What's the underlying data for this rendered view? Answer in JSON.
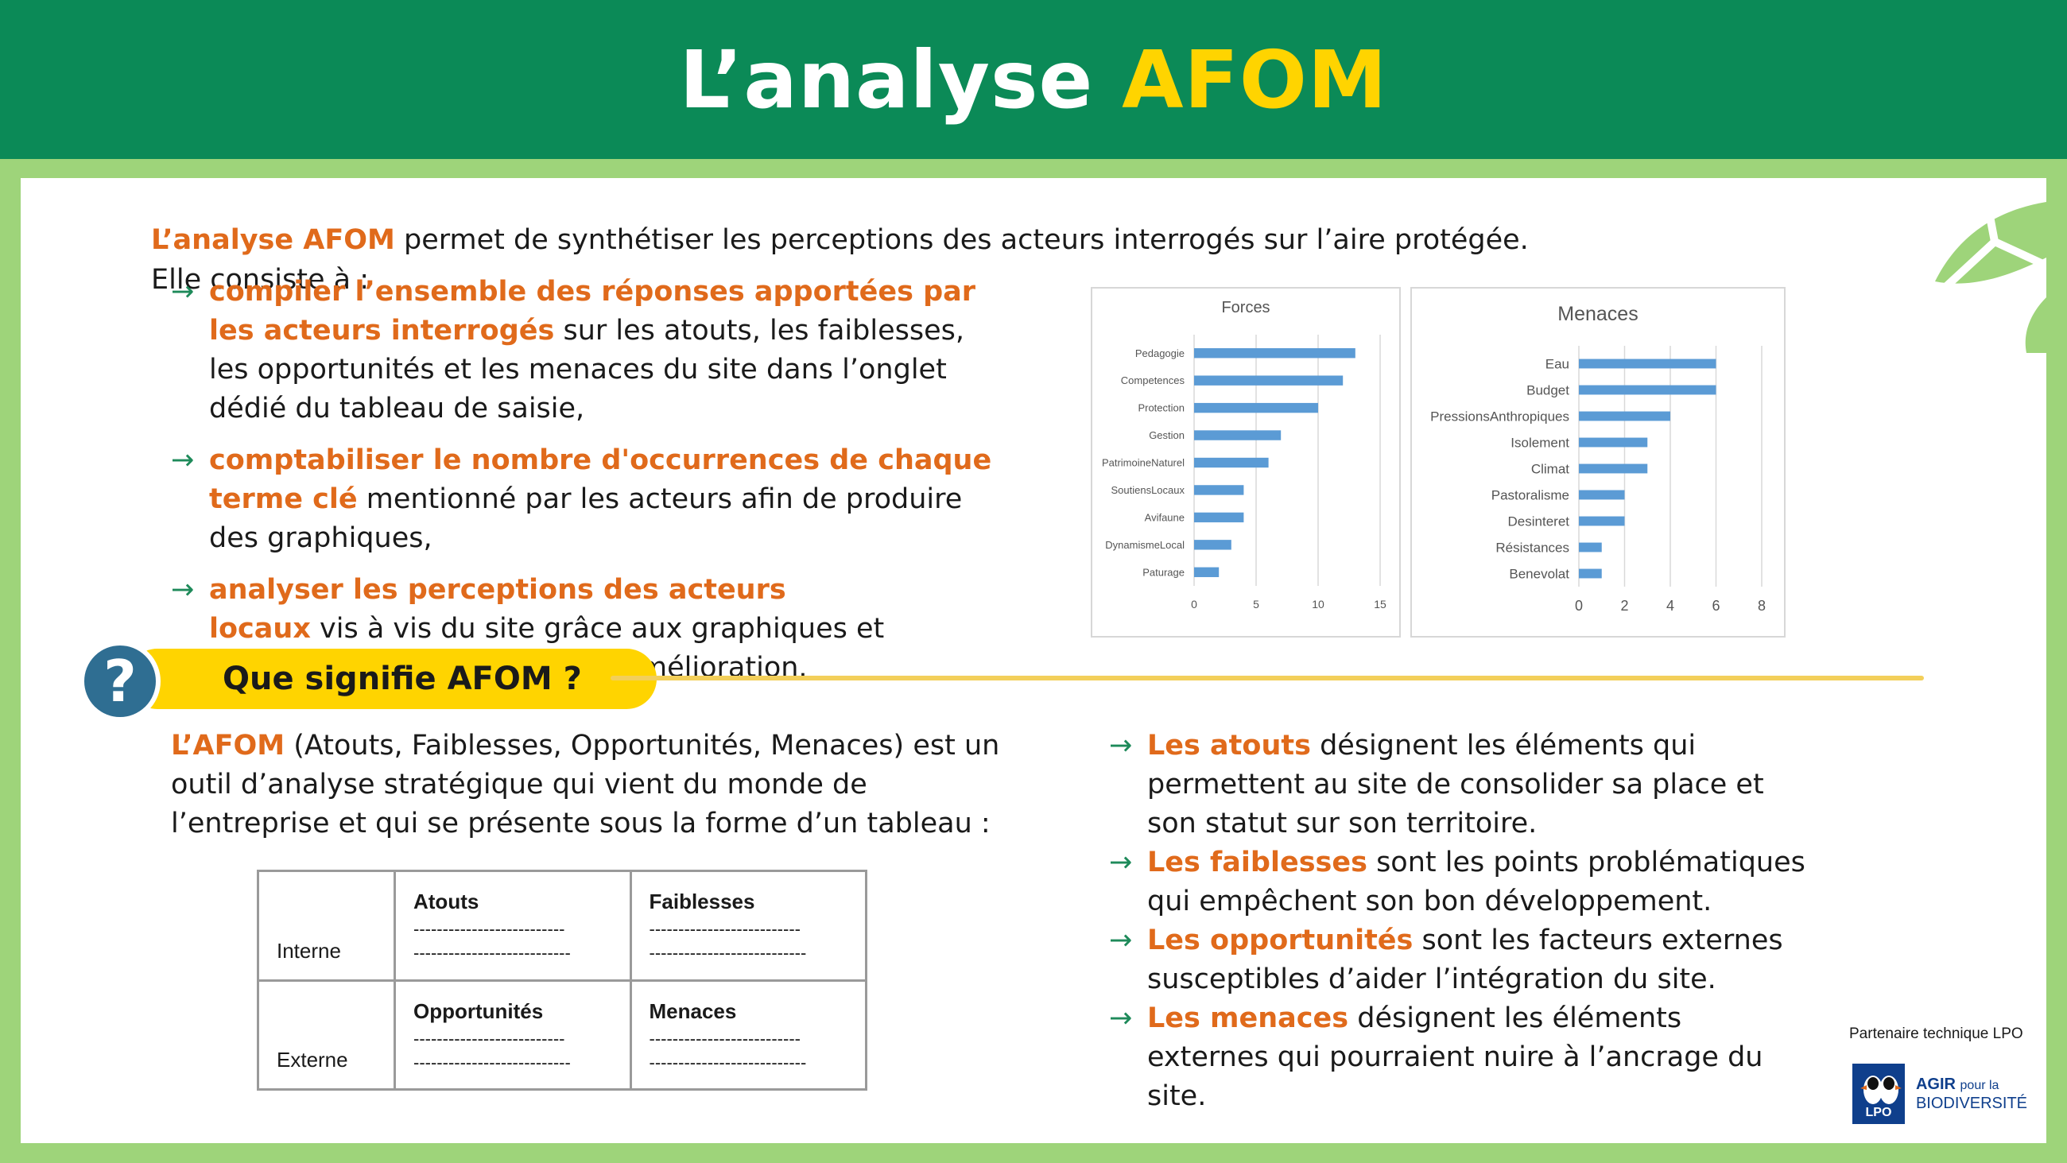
{
  "header": {
    "title_part1": "L’analyse ",
    "title_part2": "AFOM"
  },
  "intro": {
    "lead_bold": "L’analyse AFOM",
    "lead_rest": " permet de synthétiser les perceptions des acteurs interrogés sur l’aire protégée. Elle consiste à :"
  },
  "bullets": [
    {
      "arrow": "→",
      "bold": "compiler l’ensemble des réponses apportées par les acteurs interrogés",
      "rest": " sur les atouts, les faiblesses, les opportunités et les menaces du site dans l’onglet dédié du tableau de saisie,"
    },
    {
      "arrow": "→",
      "bold": "comptabiliser le nombre d'occurrences de chaque terme clé",
      "rest": " mentionné par les acteurs afin de produire des graphiques,"
    },
    {
      "arrow": "→",
      "bold": "analyser les perceptions des acteurs locaux",
      "rest": " vis à vis du site grâce aux graphiques et identifier les premiers axes d’amélioration."
    }
  ],
  "chart_data": [
    {
      "type": "bar",
      "orientation": "horizontal",
      "title": "Forces",
      "categories": [
        "Pedagogie",
        "Competences",
        "Protection",
        "Gestion",
        "PatrimoineNaturel",
        "SoutiensLocaux",
        "Avifaune",
        "DynamismeLocal",
        "Paturage"
      ],
      "values": [
        13,
        12,
        10,
        7,
        6,
        4,
        4,
        3,
        2
      ],
      "xlim": [
        0,
        15
      ],
      "xticks": [
        0,
        5,
        10,
        15
      ],
      "grid": true,
      "color": "#5b9bd5"
    },
    {
      "type": "bar",
      "orientation": "horizontal",
      "title": "Menaces",
      "categories": [
        "Eau",
        "Budget",
        "PressionsAnthropiques",
        "Isolement",
        "Climat",
        "Pastoralisme",
        "Desinteret",
        "Résistances",
        "Benevolat"
      ],
      "values": [
        6,
        6,
        4,
        3,
        3,
        2,
        2,
        1,
        1
      ],
      "xlim": [
        0,
        8
      ],
      "xticks": [
        0,
        2,
        4,
        6,
        8
      ],
      "grid": true,
      "color": "#5b9bd5"
    }
  ],
  "section": {
    "icon": "?",
    "title": "Que signifie AFOM ?"
  },
  "definition": {
    "bold": "L’AFOM",
    "rest": " (Atouts, Faiblesses, Opportunités, Menaces) est un outil d’analyse stratégique qui vient du monde de l’entreprise et qui se présente sous la forme d’un tableau :"
  },
  "table": {
    "rows": [
      {
        "label": "Interne",
        "cells": [
          {
            "title": "Atouts",
            "line1": "--------------------------",
            "line2": "---------------------------"
          },
          {
            "title": "Faiblesses",
            "line1": "--------------------------",
            "line2": "---------------------------"
          }
        ]
      },
      {
        "label": "Externe",
        "cells": [
          {
            "title": "Opportunités",
            "line1": "--------------------------",
            "line2": "---------------------------"
          },
          {
            "title": "Menaces",
            "line1": "--------------------------",
            "line2": "---------------------------"
          }
        ]
      }
    ]
  },
  "explanations": [
    {
      "arrow": "→",
      "bold": "Les atouts",
      "rest": " désignent les éléments qui permettent au site de consolider sa place et son statut sur son territoire."
    },
    {
      "arrow": "→",
      "bold": "Les faiblesses",
      "rest": " sont les points problématiques qui empêchent son bon développement."
    },
    {
      "arrow": "→",
      "bold": "Les opportunités",
      "rest": " sont les facteurs externes susceptibles d’aider l’intégration du site."
    },
    {
      "arrow": "→",
      "bold": "Les menaces",
      "rest": " désignent les éléments externes qui pourraient nuire à l’ancrage du site."
    }
  ],
  "footer": {
    "partner": "Partenaire technique LPO",
    "logo_lpo": "LPO",
    "logo_agir": "AGIR",
    "logo_pour_la": "pour la",
    "logo_biodiv": "BIODIVERSITÉ"
  },
  "colors": {
    "header_green": "#0b8a57",
    "frame_green": "#9ed47a",
    "accent_yellow": "#ffd400",
    "orange": "#e06a1b",
    "arrow_green": "#1e8a5a",
    "badge_blue": "#2f6e92",
    "bar_blue": "#5b9bd5"
  }
}
